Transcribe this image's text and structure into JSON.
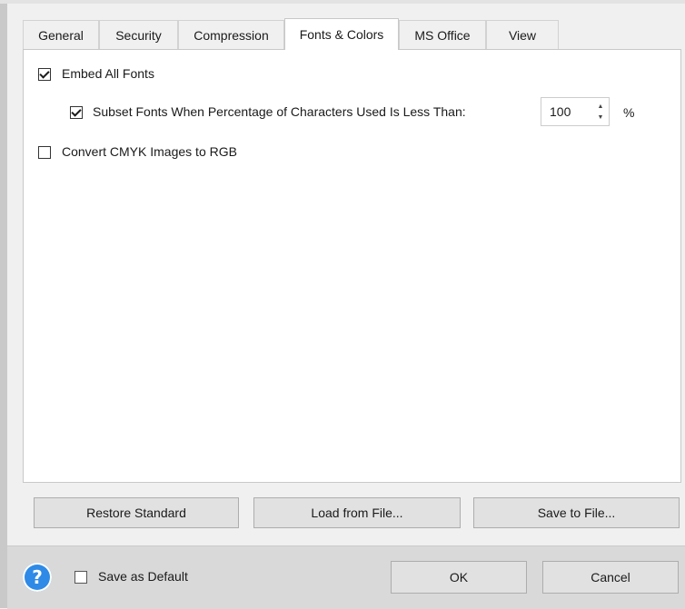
{
  "tabs": [
    {
      "label": "General"
    },
    {
      "label": "Security"
    },
    {
      "label": "Compression"
    },
    {
      "label": "Fonts & Colors",
      "active": true
    },
    {
      "label": "MS Office"
    },
    {
      "label": "View"
    }
  ],
  "options": {
    "embed_all_fonts": {
      "label": "Embed All Fonts",
      "checked": true
    },
    "subset_fonts": {
      "label": "Subset Fonts When Percentage of Characters Used Is Less Than:",
      "checked": true,
      "value": "100",
      "unit": "%"
    },
    "convert_cmyk": {
      "label": "Convert CMYK Images to RGB",
      "checked": false
    }
  },
  "actions": {
    "restore_standard": "Restore Standard",
    "load_from_file": "Load from File...",
    "save_to_file": "Save to File..."
  },
  "footer": {
    "help_glyph": "?",
    "save_as_default": {
      "label": "Save as Default",
      "checked": false
    },
    "ok": "OK",
    "cancel": "Cancel"
  },
  "colors": {
    "help_icon": "#2e8ae6",
    "panel": "#ffffff",
    "dialog_bg": "#f0f0f0"
  }
}
